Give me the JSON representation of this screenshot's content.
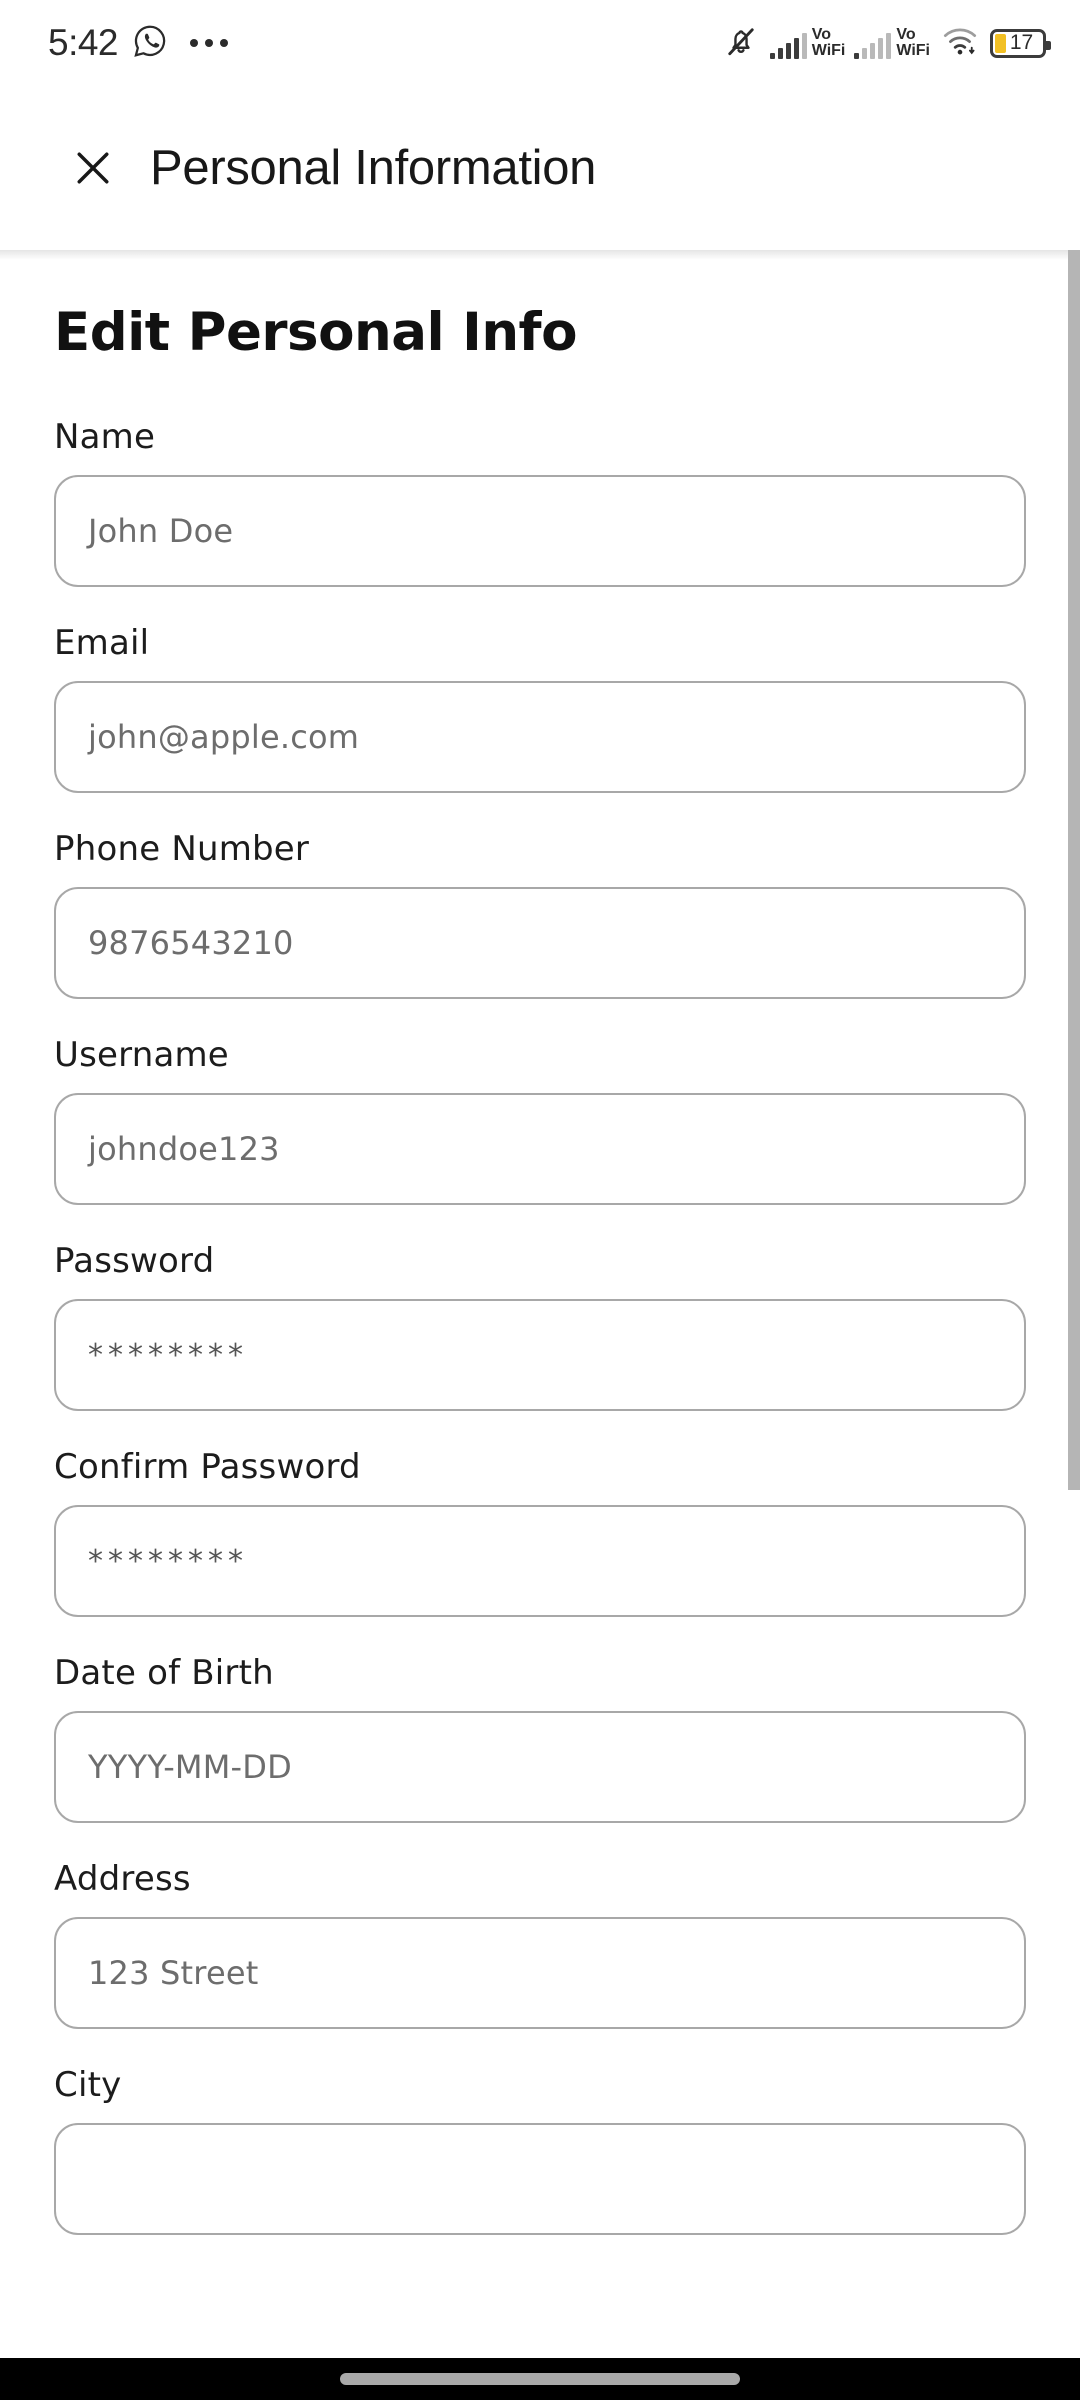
{
  "status_bar": {
    "time": "5:42",
    "whatsapp_icon": "whatsapp-icon",
    "overflow_icon": "more-notifications-icon",
    "mute_icon": "ringer-muted-icon",
    "sim1_label": "Vo\nWiFi",
    "sim1_line1": "Vo",
    "sim1_line2": "WiFi",
    "sim2_line1": "Vo",
    "sim2_line2": "WiFi",
    "wifi_icon": "wifi-icon",
    "battery_percent": "17"
  },
  "header": {
    "close_icon": "close-icon",
    "title": "Personal Information"
  },
  "main": {
    "page_title": "Edit Personal Info",
    "fields": [
      {
        "label": "Name",
        "value": "John Doe",
        "masked": false
      },
      {
        "label": "Email",
        "value": "john@apple.com",
        "masked": false
      },
      {
        "label": "Phone Number",
        "value": "9876543210",
        "masked": false
      },
      {
        "label": "Username",
        "value": "johndoe123",
        "masked": false
      },
      {
        "label": "Password",
        "value": "********",
        "masked": true
      },
      {
        "label": "Confirm Password",
        "value": "********",
        "masked": true
      },
      {
        "label": "Date of Birth",
        "value": "YYYY-MM-DD",
        "masked": false
      },
      {
        "label": "Address",
        "value": "123 Street",
        "masked": false
      },
      {
        "label": "City",
        "value": "",
        "masked": false
      }
    ]
  },
  "colors": {
    "background": "#ffffff",
    "text": "#181818",
    "placeholder": "#6d6d6d",
    "border": "#a8a8a8",
    "battery_accent": "#f2c024",
    "scrollbar": "#b5b5b5",
    "nav_bar": "#000000"
  },
  "nav_bar": {
    "gesture_pill": "gesture-pill"
  }
}
